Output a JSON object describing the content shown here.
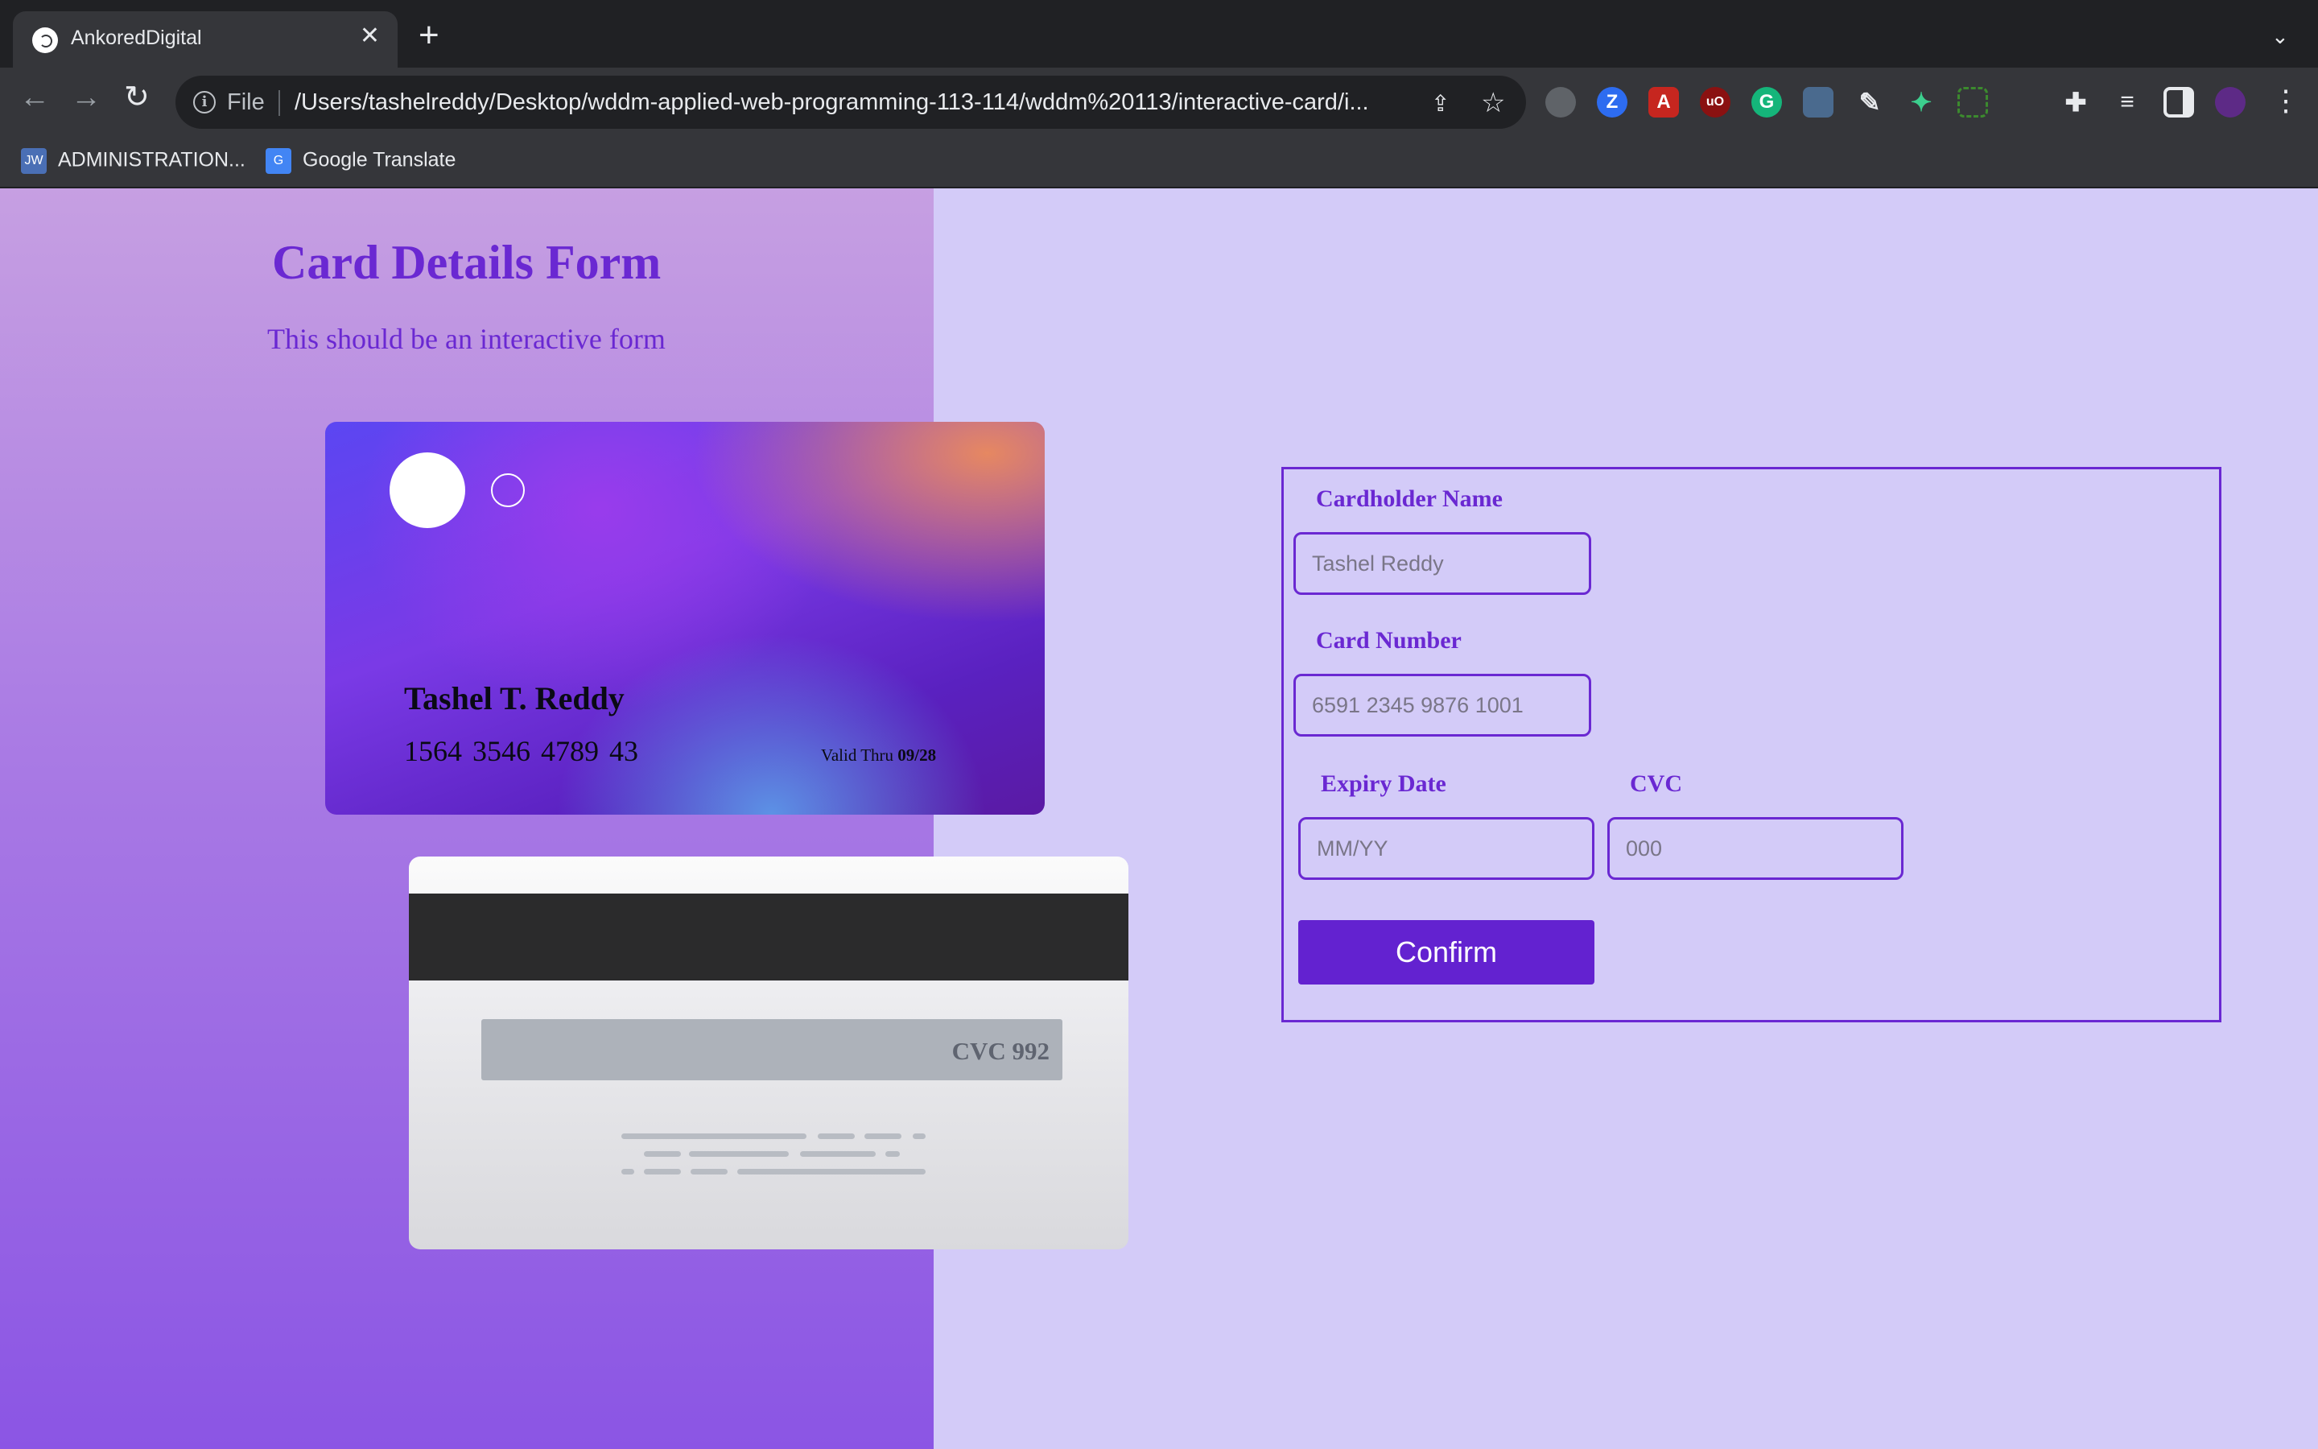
{
  "browser": {
    "tab_title": "AnkoredDigital",
    "address": {
      "scheme_label": "File",
      "url": "/Users/tashelreddy/Desktop/wddm-applied-web-programming-113-114/wddm%20113/interactive-card/i..."
    },
    "bookmarks": [
      {
        "label": "ADMINISTRATION...",
        "icon": "JW"
      },
      {
        "label": "Google Translate",
        "icon": "translate-icon"
      }
    ],
    "extension_icons": [
      "drive-icon",
      "zoom-icon",
      "pdf-icon",
      "ublock-icon",
      "grammarly-icon",
      "qr-icon",
      "eyedropper-icon",
      "bird-icon",
      "screenshot-icon",
      "extensions-icon",
      "media-icon",
      "sidepanel-icon",
      "profile-icon"
    ]
  },
  "page": {
    "title": "Card Details Form",
    "subtitle": "This should be an interactive form"
  },
  "card_front": {
    "name": "Tashel T. Reddy",
    "number": "1564 3546 4789 43",
    "valid_label": "Valid Thru",
    "valid_value": "09/28"
  },
  "card_back": {
    "cvc": "CVC 992"
  },
  "form": {
    "cardholder_label": "Cardholder Name",
    "cardholder_placeholder": "Tashel Reddy",
    "number_label": "Card Number",
    "number_placeholder": "6591 2345 9876 1001",
    "expiry_label": "Expiry Date",
    "expiry_placeholder": "MM/YY",
    "cvc_label": "CVC",
    "cvc_placeholder": "000",
    "confirm_label": "Confirm"
  },
  "colors": {
    "accent": "#6a28d2",
    "button": "#6322d0",
    "page_bg": "#d3cbf8"
  }
}
